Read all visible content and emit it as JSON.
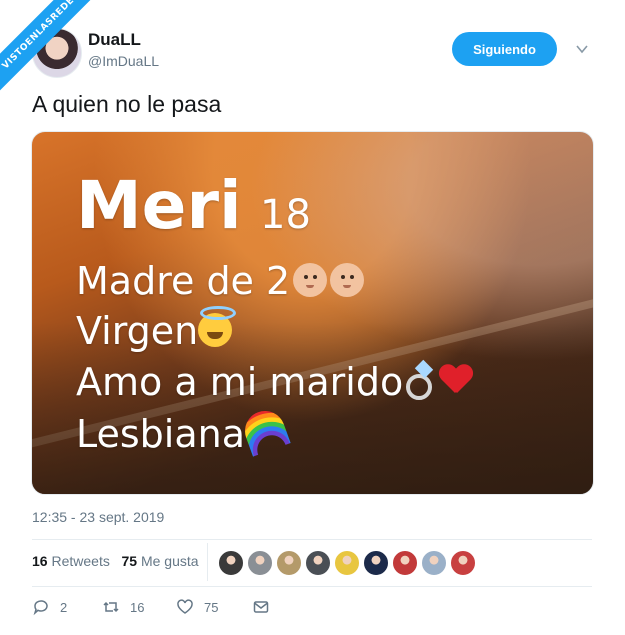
{
  "watermark": {
    "line1": "VISTOENLASREDES",
    "line2": ".com"
  },
  "user": {
    "display_name": "DuaLL",
    "handle": "@ImDuaLL"
  },
  "follow_button_label": "Siguiendo",
  "tweet": {
    "text": "A quien no le pasa",
    "timestamp": "12:35 - 23 sept. 2019"
  },
  "image_overlay": {
    "name": "Meri",
    "age": "18",
    "line1": "Madre de 2",
    "line2": "Virgen",
    "line3": "Amo a mi marido",
    "line4": "Lesbiana"
  },
  "stats": {
    "retweets_count": "16",
    "retweets_label": "Retweets",
    "likes_count": "75",
    "likes_label": "Me gusta"
  },
  "liker_avatars": [
    {
      "color": "#3a3a3a"
    },
    {
      "color": "#8a8f95"
    },
    {
      "color": "#b49a6a"
    },
    {
      "color": "#4a4f55"
    },
    {
      "color": "#e8c640"
    },
    {
      "color": "#1c2a4a"
    },
    {
      "color": "#c23a3a"
    },
    {
      "color": "#9ab0c8"
    },
    {
      "color": "#c84040"
    }
  ],
  "actions": {
    "replies": "2",
    "retweets": "16",
    "likes": "75"
  },
  "icons": [
    "chevron-down-icon",
    "reply-icon",
    "retweet-icon",
    "heart-icon",
    "message-icon"
  ]
}
